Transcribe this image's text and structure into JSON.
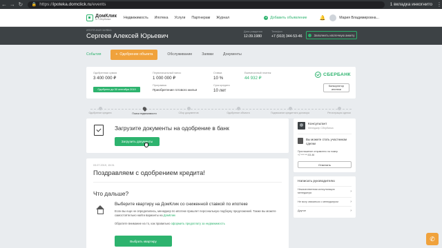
{
  "browser": {
    "url_prefix": "https://",
    "url_host": "ipoteka.domclick.ru",
    "url_path": "/events",
    "incognito_label": "1 вкладка инкогнито"
  },
  "header": {
    "logo_name": "ДомКлик",
    "logo_sub": "от Сбербанка",
    "nav": [
      "Недвижимость",
      "Ипотека",
      "Услуги",
      "Партнерам",
      "Журнал"
    ],
    "add_ad": "Добавить объявление",
    "user_name": "Мария Владимировна..."
  },
  "profile": {
    "tag": "ИПОТЕЧНАЯ ЗАЯВКА",
    "name": "Сергеев Алексей Юрьевич",
    "birth_label": "Дата рождения",
    "birth_value": "12.09.1980",
    "phone_label": "Телефон",
    "phone_value": "+7 (910) 344-53-46",
    "mortgage_btn": "Заполнить ипотечную анкету"
  },
  "tabs": {
    "events": "События",
    "approve": "Одобрение объекта",
    "service": "Обслуживание",
    "deals": "Заявки",
    "documents": "Документы"
  },
  "summary": {
    "approved_label": "Одобренная сумма",
    "approved_value": "3 400 000 ₽",
    "initial_label": "Первоначальный взнос",
    "initial_value": "1 000 000 ₽",
    "rate_label": "Ставка",
    "rate_value": "10 %",
    "payment_label": "Ежемесячный платеж",
    "payment_value": "44 932 ₽",
    "program_label": "Программа",
    "program_value": "Приобретение готового жилья",
    "term_label": "Срок кредита",
    "term_value": "10 лет",
    "badge": "Одобрено до 30 сентября 2019",
    "bank": "СБЕРБАНК",
    "calc_btn": "Калькулятор ипотеки"
  },
  "progress": {
    "steps": [
      "Одобрение кредита",
      "Поиск недвижимости",
      "Сбор документов",
      "Одобрение объекта",
      "Подписание кредитного договора",
      "Регистрация сделки"
    ],
    "active_index": 1
  },
  "upload": {
    "title": "Загрузите документы на одобрение в банк",
    "button": "Загрузить документы"
  },
  "congrats": {
    "date": "03.07.2019, 15:31",
    "title": "Поздравляем с одобрением кредита!",
    "what_next": "Что дальше?",
    "subtitle": "Выберите квартиру на ДомКлик со сниженной ставкой по ипотеке",
    "text_part1": "Если вы еще не определились, менеджер по ипотеке пришлет персональную подборку предложений. Также вы можете самостоятельно найти варианты на ",
    "text_link": "ДомКлик",
    "note_part1": "Обратите внимание на то, как правильно ",
    "note_link": "оформить предоплату за недвижимость",
    "button": "Выбрать квартиру"
  },
  "sidebar": {
    "consultant_name": "Консультант",
    "consultant_role": "Менеджер Сбербанка",
    "question": "Вы можете стать участником сделки",
    "invite_line1": "Приглашение отправлено на номер",
    "invite_line2": "+7 *** ***-53-46",
    "cancel_btn": "Отменить",
    "write_title": "Написать руководителю",
    "rows": [
      "Некачественная консультация менеджера",
      "Не могу связаться с менеджером",
      "Другое"
    ]
  }
}
